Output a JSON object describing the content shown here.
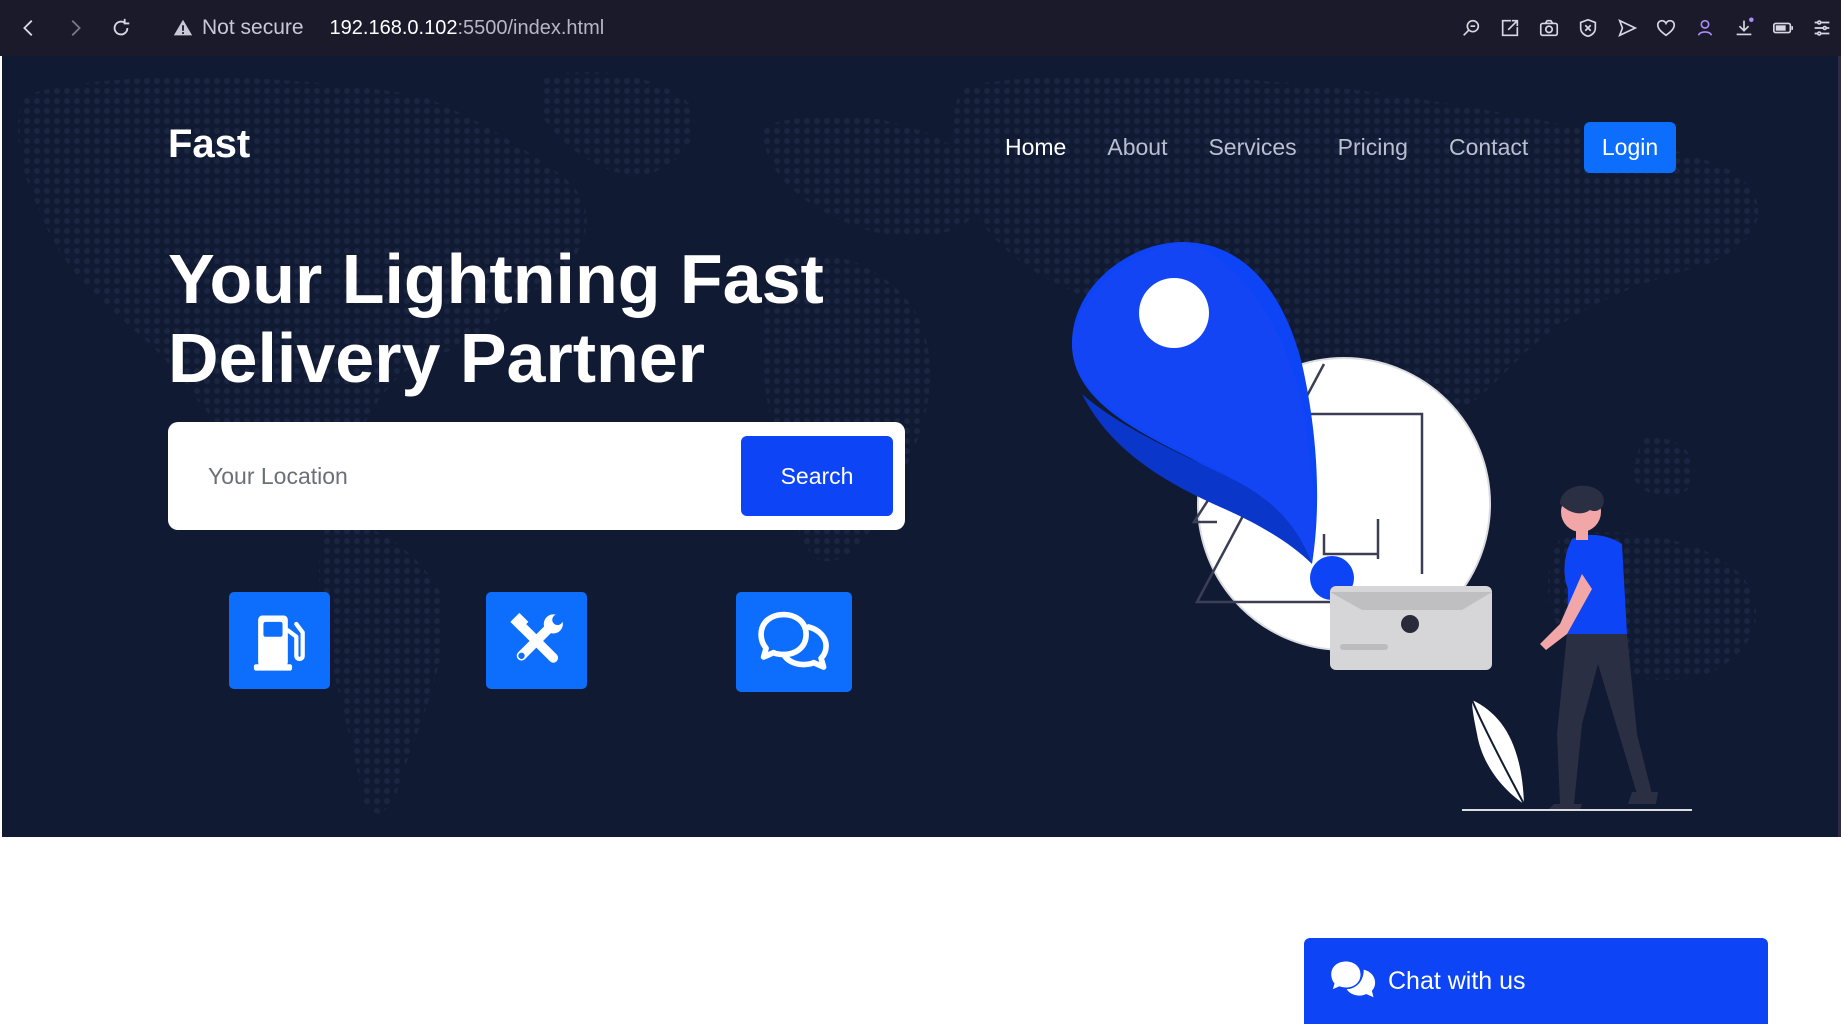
{
  "browser": {
    "security_label": "Not secure",
    "url_host": "192.168.0.102",
    "url_rest": ":5500/index.html",
    "icons": [
      "back-icon",
      "forward-icon",
      "reload-icon",
      "warning-icon",
      "search-icon",
      "share-icon",
      "camera-icon",
      "shield-icon",
      "send-icon",
      "heart-icon",
      "profile-icon",
      "download-icon",
      "battery-icon",
      "menu-icon"
    ]
  },
  "header": {
    "brand": "Fast",
    "nav": [
      {
        "label": "Home",
        "active": true
      },
      {
        "label": "About",
        "active": false
      },
      {
        "label": "Services",
        "active": false
      },
      {
        "label": "Pricing",
        "active": false
      },
      {
        "label": "Contact",
        "active": false
      }
    ],
    "login_label": "Login"
  },
  "hero": {
    "headline": "Your Lightning Fast Delivery Partner",
    "search_placeholder": "Your Location",
    "search_button": "Search",
    "features": [
      {
        "icon": "gas-pump-icon"
      },
      {
        "icon": "tools-icon"
      },
      {
        "icon": "comments-icon"
      }
    ]
  },
  "chat": {
    "label": "Chat with us",
    "icon": "comments-icon"
  },
  "colors": {
    "hero_bg": "#111a33",
    "accent": "#0d6efd",
    "accent_dark": "#0d44f6",
    "browser_bar": "#1b1a2b"
  }
}
